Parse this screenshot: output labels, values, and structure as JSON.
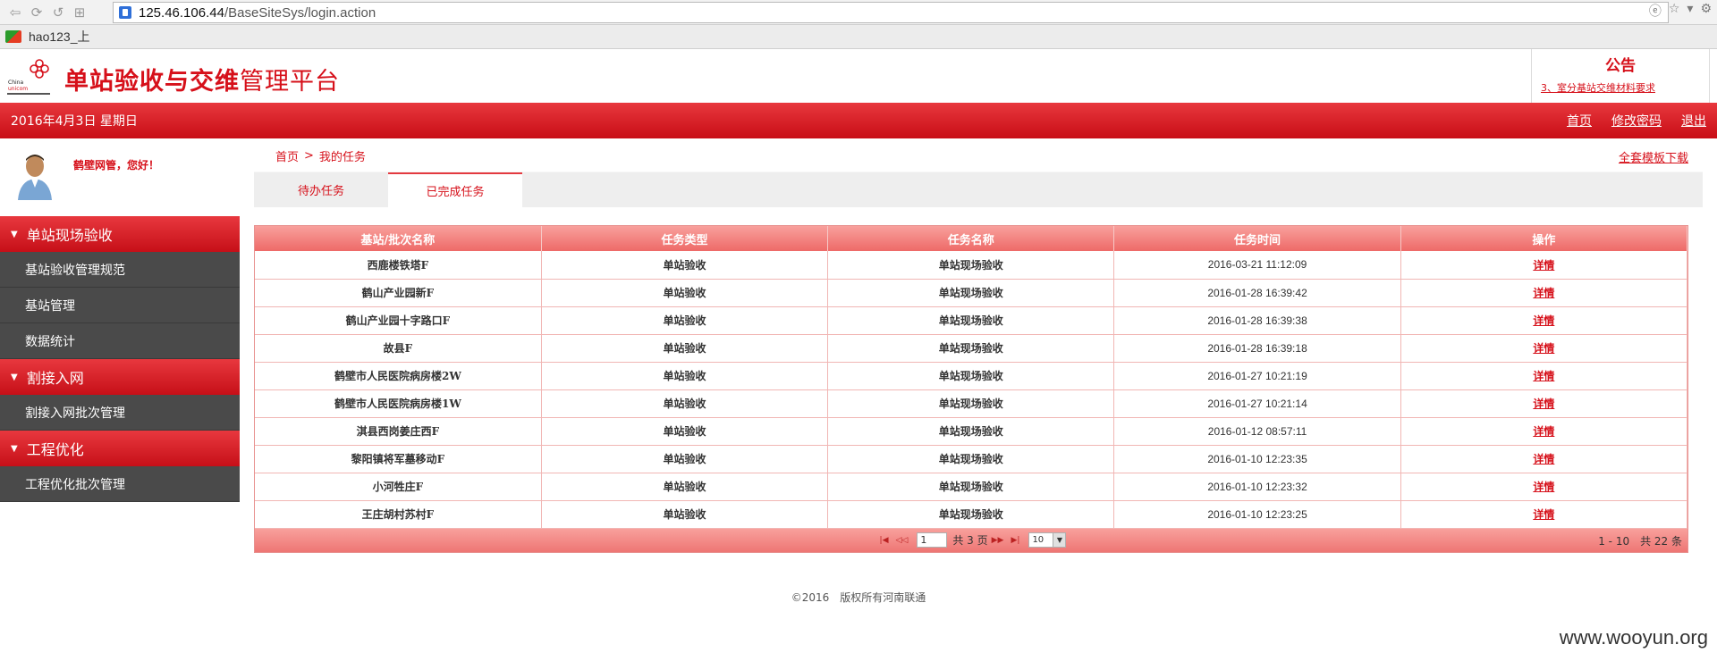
{
  "browser": {
    "url_host": "125.46.106.44",
    "url_path": "/BaseSiteSys/login.action",
    "bookmark": "hao123_上"
  },
  "header": {
    "title_bold": "单站验收与交维",
    "title_rest": "管理平台",
    "notice_title": "公告",
    "notice_item": "3、室分基站交维材料要求"
  },
  "topbar": {
    "date": "2016年4月3日 星期日",
    "home": "首页",
    "change_password": "修改密码",
    "logout": "退出"
  },
  "user": {
    "greeting": "鹤壁网管，您好！"
  },
  "sidebar": {
    "groups": [
      {
        "label": "单站现场验收",
        "items": [
          "基站验收管理规范",
          "基站管理",
          "数据统计"
        ]
      },
      {
        "label": "割接入网",
        "items": [
          "割接入网批次管理"
        ]
      },
      {
        "label": "工程优化",
        "items": [
          "工程优化批次管理"
        ]
      }
    ]
  },
  "main": {
    "breadcrumb_home": "首页",
    "breadcrumb_sep": ">",
    "breadcrumb_current": "我的任务",
    "download": "全套模板下载",
    "tabs": [
      "待办任务",
      "已完成任务"
    ]
  },
  "table": {
    "headers": [
      "基站/批次名称",
      "任务类型",
      "任务名称",
      "任务时间",
      "操作"
    ],
    "rows": [
      [
        "西鹿楼铁塔F",
        "单站验收",
        "单站现场验收",
        "2016-03-21 11:12:09",
        "详情"
      ],
      [
        "鹤山产业园新F",
        "单站验收",
        "单站现场验收",
        "2016-01-28 16:39:42",
        "详情"
      ],
      [
        "鹤山产业园十字路口F",
        "单站验收",
        "单站现场验收",
        "2016-01-28 16:39:38",
        "详情"
      ],
      [
        "故县F",
        "单站验收",
        "单站现场验收",
        "2016-01-28 16:39:18",
        "详情"
      ],
      [
        "鹤壁市人民医院病房楼2W",
        "单站验收",
        "单站现场验收",
        "2016-01-27 10:21:19",
        "详情"
      ],
      [
        "鹤壁市人民医院病房楼1W",
        "单站验收",
        "单站现场验收",
        "2016-01-27 10:21:14",
        "详情"
      ],
      [
        "淇县西岗姜庄西F",
        "单站验收",
        "单站现场验收",
        "2016-01-12 08:57:11",
        "详情"
      ],
      [
        "黎阳镇将军墓移动F",
        "单站验收",
        "单站现场验收",
        "2016-01-10 12:23:35",
        "详情"
      ],
      [
        "小河牲庄F",
        "单站验收",
        "单站现场验收",
        "2016-01-10 12:23:32",
        "详情"
      ],
      [
        "王庄胡村苏村F",
        "单站验收",
        "单站现场验收",
        "2016-01-10 12:23:25",
        "详情"
      ]
    ]
  },
  "pager": {
    "page": "1",
    "total_pages": "共 3 页",
    "page_size": "10",
    "summary": "1 - 10　共 22 条"
  },
  "footer": "©2016　版权所有河南联通",
  "watermark": "www.wooyun.org",
  "colors": {
    "brand_red": "#d6101a",
    "menu_dark": "#4a4a4a"
  }
}
